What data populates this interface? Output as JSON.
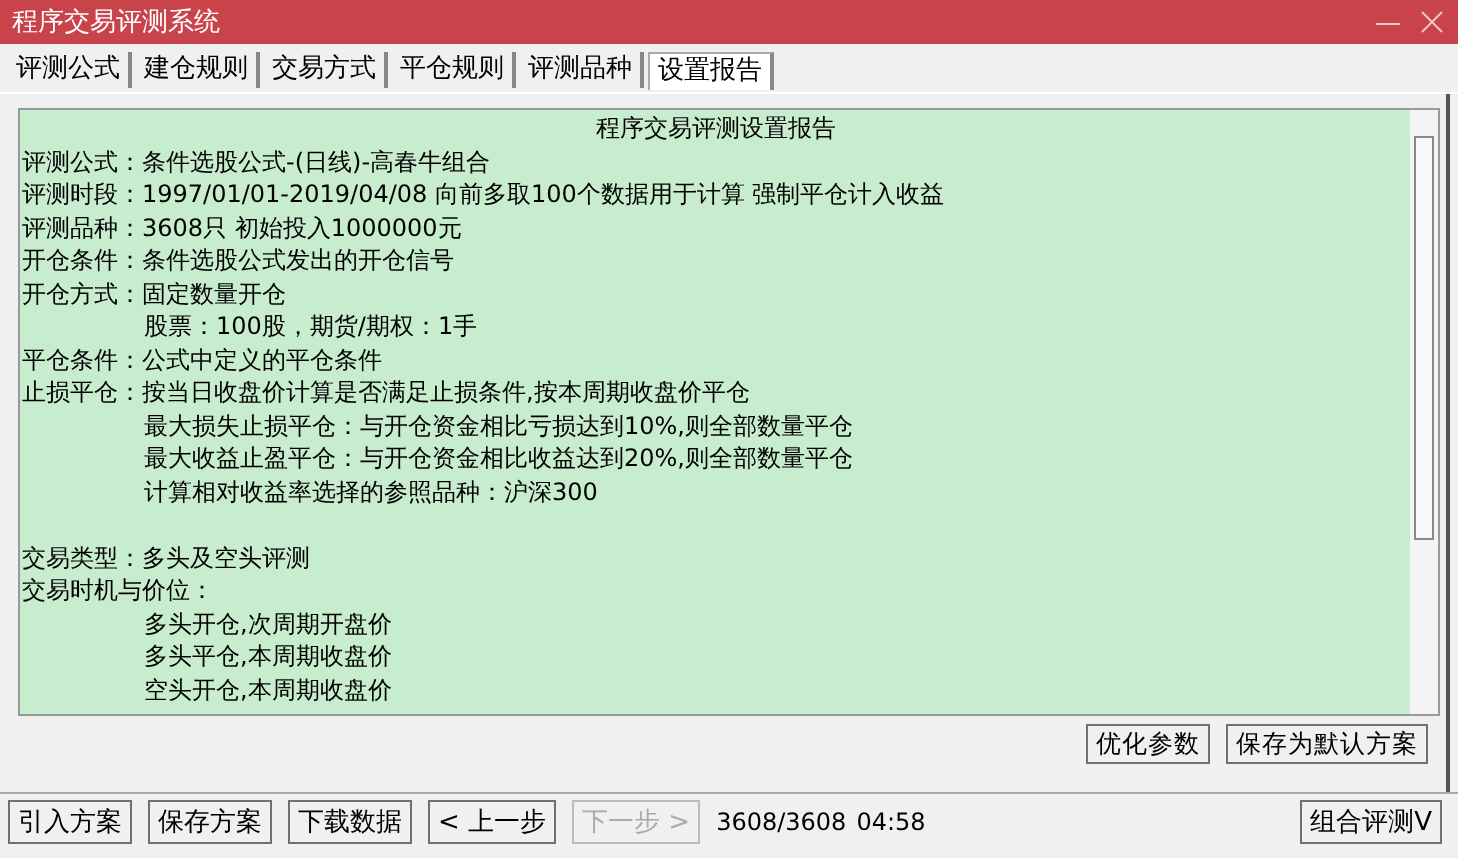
{
  "window": {
    "title": "程序交易评测系统"
  },
  "tabs": [
    {
      "label": "评测公式",
      "selected": false
    },
    {
      "label": "建仓规则",
      "selected": false
    },
    {
      "label": "交易方式",
      "selected": false
    },
    {
      "label": "平仓规则",
      "selected": false
    },
    {
      "label": "评测品种",
      "selected": false
    },
    {
      "label": "设置报告",
      "selected": true
    }
  ],
  "report": {
    "title": "程序交易评测设置报告",
    "lines": [
      {
        "kind": "field",
        "label": "评测公式：",
        "text": "条件选股公式-(日线)-高春牛组合"
      },
      {
        "kind": "field",
        "label": "评测时段：",
        "text": "1997/01/01-2019/04/08 向前多取100个数据用于计算 强制平仓计入收益"
      },
      {
        "kind": "field",
        "label": "评测品种：",
        "text": "3608只 初始投入1000000元"
      },
      {
        "kind": "field",
        "label": "开仓条件：",
        "text": "条件选股公式发出的开仓信号"
      },
      {
        "kind": "field",
        "label": "开仓方式：",
        "text": "固定数量开仓"
      },
      {
        "kind": "indent",
        "text": "股票：100股，期货/期权：1手"
      },
      {
        "kind": "field",
        "label": "平仓条件：",
        "text": "公式中定义的平仓条件"
      },
      {
        "kind": "field",
        "label": "止损平仓：",
        "text": "按当日收盘价计算是否满足止损条件,按本周期收盘价平仓"
      },
      {
        "kind": "indent",
        "text": "最大损失止损平仓：与开仓资金相比亏损达到10%,则全部数量平仓"
      },
      {
        "kind": "indent",
        "text": "最大收益止盈平仓：与开仓资金相比收益达到20%,则全部数量平仓"
      },
      {
        "kind": "indent",
        "text": "计算相对收益率选择的参照品种：沪深300"
      },
      {
        "kind": "blank"
      },
      {
        "kind": "field",
        "label": "交易类型：",
        "text": "多头及空头评测"
      },
      {
        "kind": "field",
        "label": "交易时机与价位："
      },
      {
        "kind": "indent",
        "text": "多头开仓,次周期开盘价"
      },
      {
        "kind": "indent",
        "text": "多头平仓,本周期收盘价"
      },
      {
        "kind": "indent",
        "text": "空头开仓,本周期收盘价"
      }
    ]
  },
  "report_buttons": [
    {
      "label": "优化参数"
    },
    {
      "label": "保存为默认方案"
    }
  ],
  "footer": {
    "buttons": [
      {
        "label": "引入方案",
        "disabled": false
      },
      {
        "label": "保存方案",
        "disabled": false
      },
      {
        "label": "下载数据",
        "disabled": false
      },
      {
        "label": "< 上一步",
        "disabled": false
      },
      {
        "label": "下一步 >",
        "disabled": true
      }
    ],
    "progress": "3608/3608",
    "time": "04:58",
    "right_buttons": [
      {
        "label": "组合评测V"
      }
    ]
  }
}
